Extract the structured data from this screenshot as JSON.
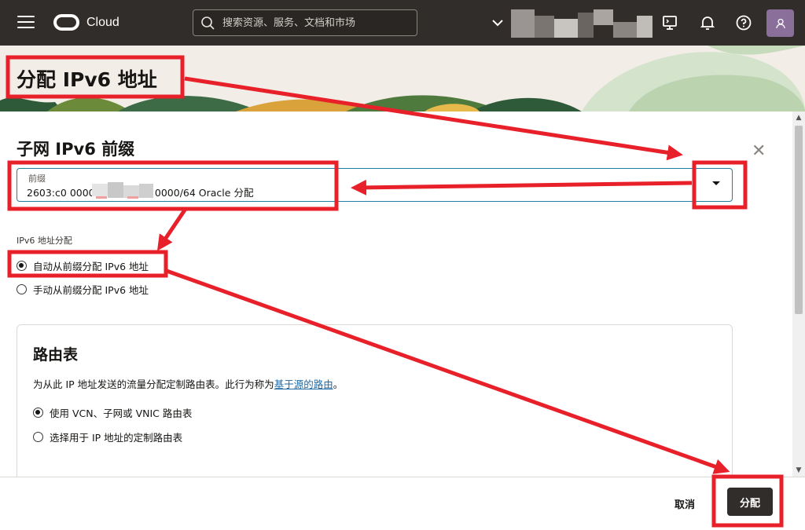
{
  "header": {
    "brand": "Cloud",
    "search_placeholder": "搜索资源、服务、文档和市场"
  },
  "panel": {
    "title": "分配 IPv6 地址"
  },
  "prefix_section": {
    "title": "子网 IPv6 前缀",
    "select_label": "前缀",
    "select_value": "2603:c0                    0000:0000:0000:0000/64 Oracle 分配"
  },
  "allocation": {
    "label": "IPv6 地址分配",
    "options": [
      {
        "label": "自动从前缀分配 IPv6 地址",
        "selected": true
      },
      {
        "label": "手动从前缀分配 IPv6 地址",
        "selected": false
      }
    ]
  },
  "route_table": {
    "title": "路由表",
    "desc_prefix": "为从此 IP 地址发送的流量分配定制路由表。此行为称为",
    "desc_link": "基于源的路由",
    "desc_suffix": "。",
    "options": [
      {
        "label": "使用 VCN、子网或 VNIC 路由表",
        "selected": true
      },
      {
        "label": "选择用于 IP 地址的定制路由表",
        "selected": false
      }
    ]
  },
  "footer": {
    "cancel_label": "取消",
    "assign_label": "分配"
  },
  "colors": {
    "header_bg": "#312d2a",
    "annotation_red": "#e8202a",
    "focus_border": "#227e9e",
    "link": "#1f6aa5"
  }
}
